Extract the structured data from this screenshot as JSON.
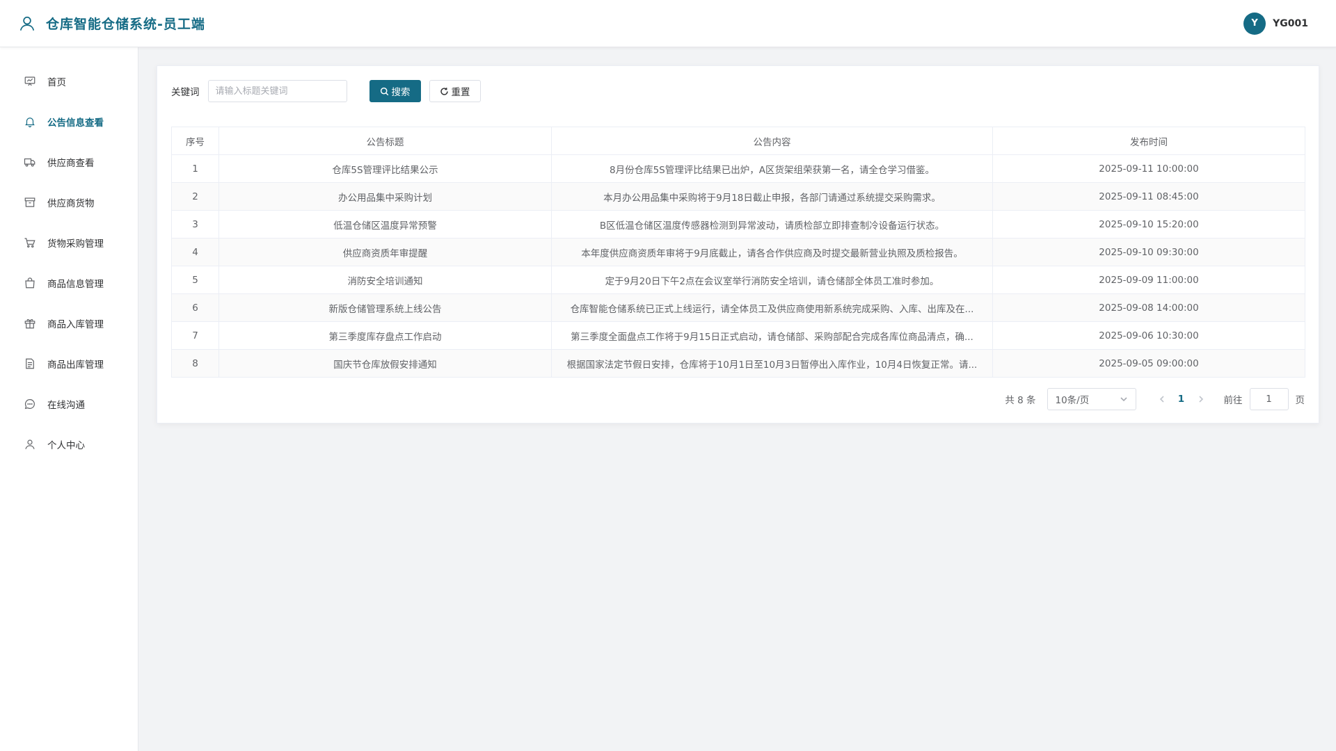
{
  "header": {
    "title": "仓库智能仓储系统-员工端",
    "user_initial": "Y",
    "user_name": "YG001",
    "logo_icon": "user-outline-icon"
  },
  "sidebar": {
    "items": [
      {
        "label": "首页",
        "icon": "home-board-icon",
        "active": false
      },
      {
        "label": "公告信息查看",
        "icon": "bell-icon",
        "active": true
      },
      {
        "label": "供应商查看",
        "icon": "truck-icon",
        "active": false
      },
      {
        "label": "供应商货物",
        "icon": "box-icon",
        "active": false
      },
      {
        "label": "货物采购管理",
        "icon": "cart-icon",
        "active": false
      },
      {
        "label": "商品信息管理",
        "icon": "bag-icon",
        "active": false
      },
      {
        "label": "商品入库管理",
        "icon": "present-icon",
        "active": false
      },
      {
        "label": "商品出库管理",
        "icon": "document-icon",
        "active": false
      },
      {
        "label": "在线沟通",
        "icon": "chat-icon",
        "active": false
      },
      {
        "label": "个人中心",
        "icon": "user-icon",
        "active": false
      }
    ]
  },
  "search": {
    "label": "关键词",
    "placeholder": "请输入标题关键词",
    "search_label": "搜索",
    "reset_label": "重置"
  },
  "table": {
    "headers": [
      "序号",
      "公告标题",
      "公告内容",
      "发布时间"
    ],
    "rows": [
      [
        "1",
        "仓库5S管理评比结果公示",
        "8月份仓库5S管理评比结果已出炉，A区货架组荣获第一名，请全仓学习借鉴。",
        "2025-09-11 10:00:00"
      ],
      [
        "2",
        "办公用品集中采购计划",
        "本月办公用品集中采购将于9月18日截止申报，各部门请通过系统提交采购需求。",
        "2025-09-11 08:45:00"
      ],
      [
        "3",
        "低温仓储区温度异常预警",
        "B区低温仓储区温度传感器检测到异常波动，请质检部立即排查制冷设备运行状态。",
        "2025-09-10 15:20:00"
      ],
      [
        "4",
        "供应商资质年审提醒",
        "本年度供应商资质年审将于9月底截止，请各合作供应商及时提交最新营业执照及质检报告。",
        "2025-09-10 09:30:00"
      ],
      [
        "5",
        "消防安全培训通知",
        "定于9月20日下午2点在会议室举行消防安全培训，请仓储部全体员工准时参加。",
        "2025-09-09 11:00:00"
      ],
      [
        "6",
        "新版仓储管理系统上线公告",
        "仓库智能仓储系统已正式上线运行，请全体员工及供应商使用新系统完成采购、入库、出库及在...",
        "2025-09-08 14:00:00"
      ],
      [
        "7",
        "第三季度库存盘点工作启动",
        "第三季度全面盘点工作将于9月15日正式启动，请仓储部、采购部配合完成各库位商品清点，确...",
        "2025-09-06 10:30:00"
      ],
      [
        "8",
        "国庆节仓库放假安排通知",
        "根据国家法定节假日安排，仓库将于10月1日至10月3日暂停出入库作业，10月4日恢复正常。请...",
        "2025-09-05 09:00:00"
      ]
    ]
  },
  "pagination": {
    "total": "共 8 条",
    "page_size": "10条/页",
    "current_page": "1",
    "goto_label": "前往",
    "goto_value": "1",
    "page_suffix": "页"
  },
  "colors": {
    "primary": "#156b85"
  }
}
